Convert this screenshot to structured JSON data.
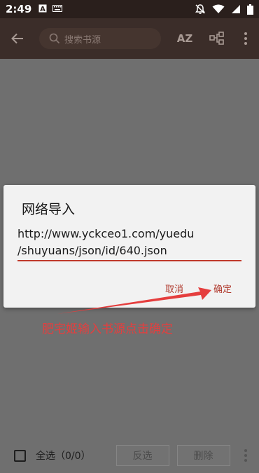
{
  "status_bar": {
    "time": "2:49",
    "left_icons": [
      "a-box-icon",
      "keyboard-icon"
    ],
    "right_icons": [
      "bell-off-icon",
      "wifi-icon",
      "signal-icon",
      "battery-icon"
    ]
  },
  "toolbar": {
    "search_placeholder": "搜索书源",
    "sort_label": "AZ",
    "icons": [
      "back-arrow-icon",
      "search-icon",
      "sort-az-icon",
      "group-icon",
      "more-vert-icon"
    ]
  },
  "bottom_bar": {
    "select_all_label": "全选（0/0）",
    "invert_label": "反选",
    "delete_label": "删除"
  },
  "dialog": {
    "title": "网络导入",
    "url_value": "http://www.yckceo1.com/yuedu\n/shuyuans/json/id/640.json",
    "cancel_label": "取消",
    "confirm_label": "确定"
  },
  "annotation": {
    "text": "肥宅姬输入书源点击确定",
    "color": "#e53e3e"
  },
  "colors": {
    "status_bar": "#2a1f1c",
    "toolbar": "#3b2d29",
    "overlay_bg": "#6f6f6f",
    "dialog_bg": "#f2f2f2",
    "accent": "#b03a2e"
  }
}
